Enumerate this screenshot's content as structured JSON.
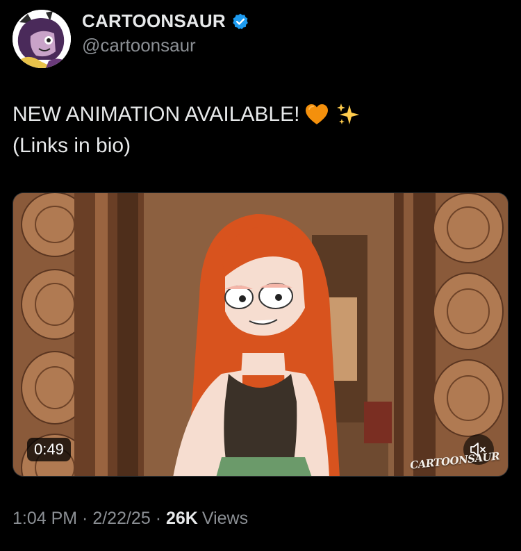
{
  "author": {
    "display_name": "CARTOONSAUR",
    "handle": "@cartoonsaur",
    "verified": true,
    "avatar_icon": "purple-haired-character-avatar",
    "verified_color": "#1d9bf0"
  },
  "tweet": {
    "line1": "NEW ANIMATION AVAILABLE!",
    "line2": "(Links in bio)",
    "emojis": [
      "orange-heart",
      "sparkles"
    ]
  },
  "media": {
    "type": "video",
    "duration": "0:49",
    "muted": true,
    "watermark": "CARTOONSAUR"
  },
  "meta": {
    "time": "1:04 PM",
    "separator": " · ",
    "date": "2/22/25",
    "views_count": "26K",
    "views_label": "Views"
  }
}
